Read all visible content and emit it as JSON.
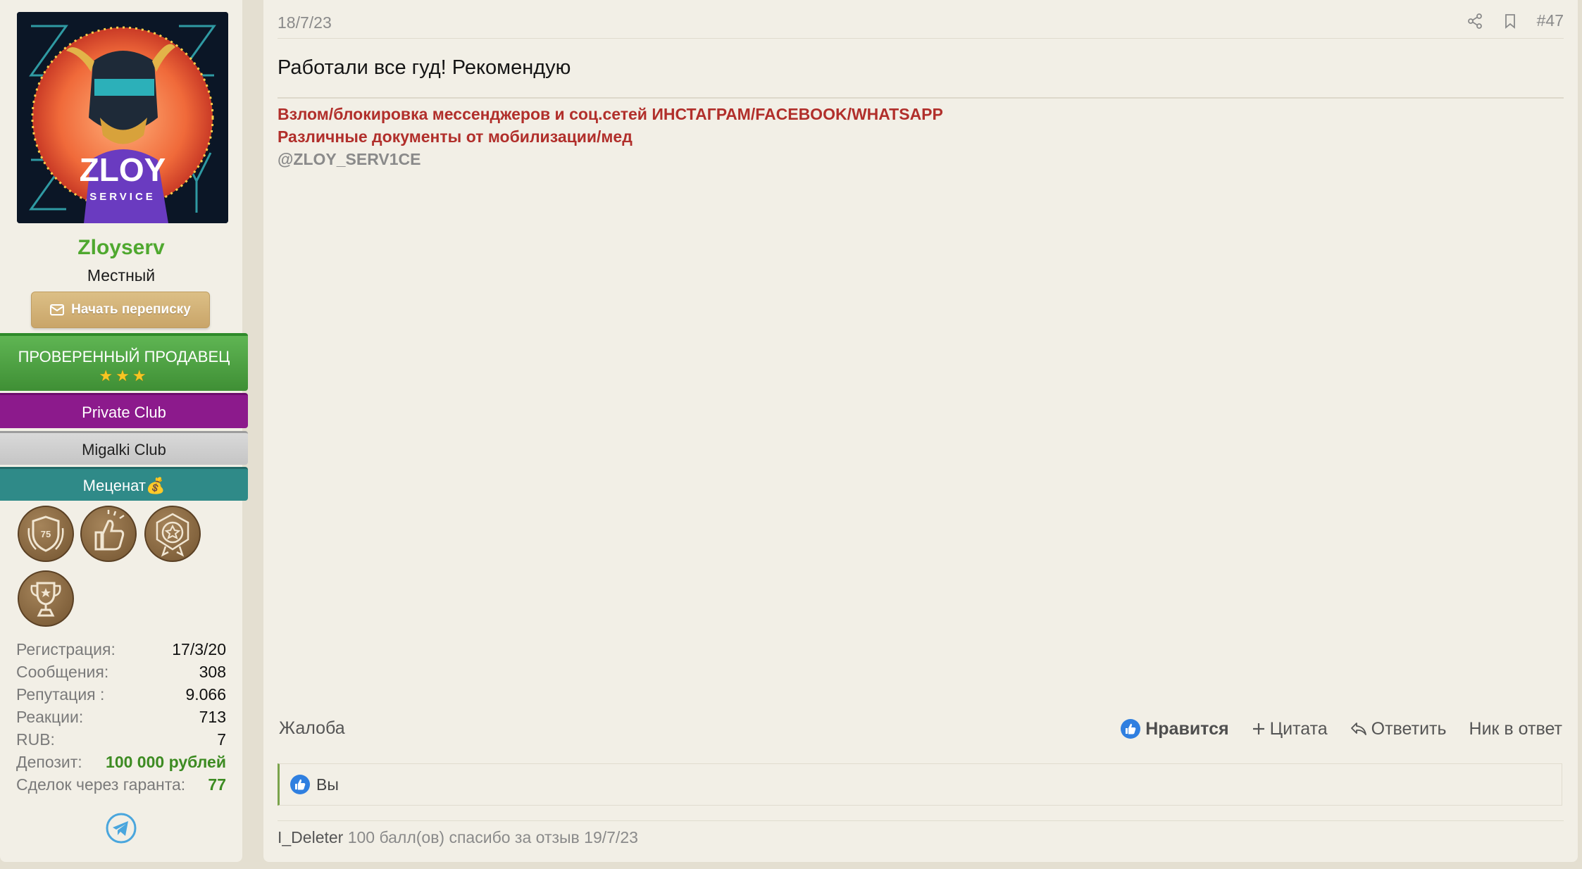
{
  "user": {
    "avatar_text": "ZLOY",
    "avatar_subtext": "SERVICE",
    "username": "Zloyserv",
    "title": "Местный",
    "message_button": "Начать переписку",
    "banners": {
      "seller": "ПРОВЕРЕННЫЙ ПРОДАВЕЦ",
      "seller_stars": "★★★",
      "private": "Private Club",
      "migalki": "Migalki Club",
      "mecenat": "Меценат💰"
    },
    "awards": [
      {
        "icon": "laurel-shield-75-icon",
        "badge": "75"
      },
      {
        "icon": "thumbs-up-award-icon"
      },
      {
        "icon": "star-medal-award-icon"
      },
      {
        "icon": "trophy-award-icon"
      }
    ],
    "stats": [
      {
        "label": "Регистрация:",
        "value": "17/3/20"
      },
      {
        "label": "Сообщения:",
        "value": "308"
      },
      {
        "label": "Репутация :",
        "value": "9.066"
      },
      {
        "label": "Реакции:",
        "value": "713"
      },
      {
        "label": "RUB:",
        "value": "7"
      },
      {
        "label": "Депозит:",
        "value": "100 000 рублей"
      },
      {
        "label": "Сделок через гаранта:",
        "value": "77"
      }
    ],
    "telegram_icon": "telegram-icon"
  },
  "post": {
    "date": "18/7/23",
    "number": "#47",
    "body": "Работали все гуд! Рекомендую",
    "signature": {
      "line1": "Взлом/блокировка мессенджеров и соц.сетей ИНСТАГРАМ/FACEBOOK/WHATSAPP",
      "line2": "Различные документы от мобилизации/мед",
      "line3": "@ZLOY_SERV1CE"
    },
    "report": "Жалоба",
    "actions": {
      "like": "Нравится",
      "quote": "Цитата",
      "reply": "Ответить",
      "mention": "Ник в ответ"
    },
    "reactions_text": "Вы",
    "thanks": {
      "user": "I_Deleter",
      "text": "100 балл(ов) спасибо за отзыв 19/7/23"
    }
  },
  "colors": {
    "accent_green": "#4fa82f",
    "signature_red": "#b12f2b",
    "private_purple": "#8c1a8c",
    "mecenat_teal": "#2f8a88",
    "button_gold": "#c9a569"
  }
}
